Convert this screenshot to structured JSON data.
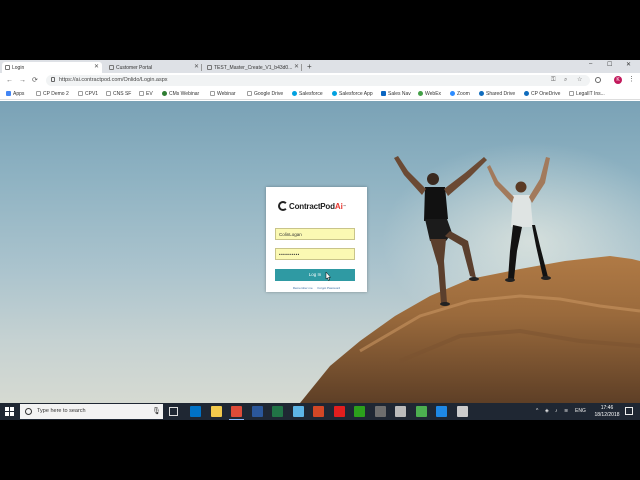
{
  "browser": {
    "tabs": [
      {
        "label": "Login",
        "active": true
      },
      {
        "label": "Customer Portal",
        "active": false
      },
      {
        "label": "TEST_Master_Create_V1_b43d0...",
        "active": false
      }
    ],
    "new_tab": "+",
    "window_controls": {
      "minimize": "–",
      "maximize": "☐",
      "close": "✕"
    },
    "nav": {
      "back": "←",
      "forward": "→",
      "reload": "⟳"
    },
    "url": "https://ai.contractpod.com/Onlido/Login.aspx",
    "omnibox_icons": [
      "key-icon",
      "zoom-icon",
      "star-icon"
    ],
    "profile_initial": "K",
    "menu": "⋮"
  },
  "bookmarks": [
    {
      "label": "Apps",
      "color": "#4285f4"
    },
    {
      "label": "CP Demo 2",
      "color": "#9e9e9e"
    },
    {
      "label": "CPV1",
      "color": "#9e9e9e"
    },
    {
      "label": "CNS SF",
      "color": "#9e9e9e"
    },
    {
      "label": "EV",
      "color": "#9e9e9e"
    },
    {
      "label": "CMs Webinar",
      "color": "#2e7d32"
    },
    {
      "label": "Webinar",
      "color": "#9e9e9e"
    },
    {
      "label": "Google Drive",
      "color": "#9e9e9e"
    },
    {
      "label": "Salesforce",
      "color": "#00a1e0"
    },
    {
      "label": "Salesforce App",
      "color": "#00a1e0"
    },
    {
      "label": "Sales Nav",
      "color": "#0a66c2"
    },
    {
      "label": "WebEx",
      "color": "#43a047"
    },
    {
      "label": "Zoom",
      "color": "#2d8cff"
    },
    {
      "label": "Shared Drive",
      "color": "#0f6cbd"
    },
    {
      "label": "CP OneDrive",
      "color": "#0f6cbd"
    },
    {
      "label": "LegalIT Ins...",
      "color": "#9e9e9e"
    }
  ],
  "login": {
    "logo_text": "ContractPod",
    "logo_ai": "Ai",
    "logo_tm": "™",
    "username_value": "ColinLogan",
    "password_value": "••••••••••",
    "login_button": "Log In",
    "remember_me": "Remember me",
    "forgot_password": "Forgot Password"
  },
  "taskbar": {
    "search_placeholder": "Type here to search",
    "apps": [
      {
        "name": "outlook-icon",
        "color": "#0072c6",
        "open": false
      },
      {
        "name": "file-explorer-icon",
        "color": "#f2c94c",
        "open": false
      },
      {
        "name": "chrome-icon",
        "color": "#dd4b39",
        "open": true
      },
      {
        "name": "word-icon",
        "color": "#2b579a",
        "open": false
      },
      {
        "name": "excel-icon",
        "color": "#217346",
        "open": false
      },
      {
        "name": "store-icon",
        "color": "#5db5e6",
        "open": false
      },
      {
        "name": "powerpoint-icon",
        "color": "#d24726",
        "open": false
      },
      {
        "name": "acrobat-icon",
        "color": "#e21e1e",
        "open": false
      },
      {
        "name": "quickbooks-icon",
        "color": "#2ca01c",
        "open": false
      },
      {
        "name": "calculator-icon",
        "color": "#6e6e6e",
        "open": false
      },
      {
        "name": "settings-icon",
        "color": "#bbbbbb",
        "open": false
      },
      {
        "name": "globe-icon",
        "color": "#4caf50",
        "open": false
      },
      {
        "name": "edge-icon",
        "color": "#1e88e5",
        "open": false
      },
      {
        "name": "clock-app-icon",
        "color": "#cccccc",
        "open": false
      }
    ],
    "tray": {
      "chevron": "^",
      "language": "ENG",
      "time": "17:46",
      "date": "18/12/2018"
    }
  },
  "colors": {
    "accent_button": "#2f9aa3",
    "input_autofill": "#fbf9b3",
    "logo_ai": "#e8352d",
    "taskbar": "#1f2733"
  }
}
